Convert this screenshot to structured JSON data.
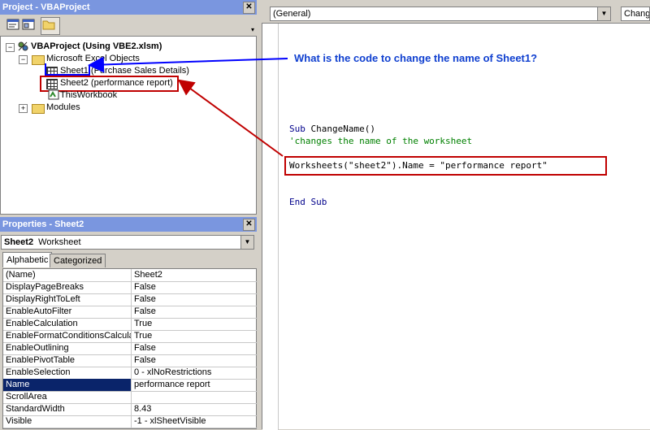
{
  "project_pane": {
    "title": "Project - VBAProject",
    "tree": {
      "root": "VBAProject (Using VBE2.xlsm)",
      "excel_objects": "Microsoft Excel Objects",
      "sheet1": "Sheet1 (Purchase Sales Details)",
      "sheet2": "Sheet2 (performance report)",
      "thisworkbook": "ThisWorkbook",
      "modules": "Modules"
    }
  },
  "properties_pane": {
    "title": "Properties - Sheet2",
    "object_name": "Sheet2",
    "object_type": "Worksheet",
    "tabs": [
      "Alphabetic",
      "Categorized"
    ],
    "rows": [
      {
        "name": "(Name)",
        "value": "Sheet2"
      },
      {
        "name": "DisplayPageBreaks",
        "value": "False"
      },
      {
        "name": "DisplayRightToLeft",
        "value": "False"
      },
      {
        "name": "EnableAutoFilter",
        "value": "False"
      },
      {
        "name": "EnableCalculation",
        "value": "True"
      },
      {
        "name": "EnableFormatConditionsCalculation",
        "value": "True"
      },
      {
        "name": "EnableOutlining",
        "value": "False"
      },
      {
        "name": "EnablePivotTable",
        "value": "False"
      },
      {
        "name": "EnableSelection",
        "value": "0 - xlNoRestrictions"
      },
      {
        "name": "Name",
        "value": "performance report"
      },
      {
        "name": "ScrollArea",
        "value": ""
      },
      {
        "name": "StandardWidth",
        "value": "8.43"
      },
      {
        "name": "Visible",
        "value": "-1 - xlSheetVisible"
      }
    ]
  },
  "code_window": {
    "object_dropdown": "(General)",
    "proc_dropdown": "Chang",
    "lines": {
      "sub_kw": "Sub",
      "sub_name": " ChangeName()",
      "comment": "'changes the name of the worksheet",
      "statement": "Worksheets(\"sheet2\").Name = \"performance report\"",
      "end_sub": "End Sub"
    }
  },
  "annotation": {
    "question": "What is the code to change the name of Sheet1?"
  },
  "colors": {
    "title_bar": "#7a96df",
    "annotation_red": "#c00000",
    "annotation_blue": "#0000ff",
    "selection": "#0a246a"
  }
}
